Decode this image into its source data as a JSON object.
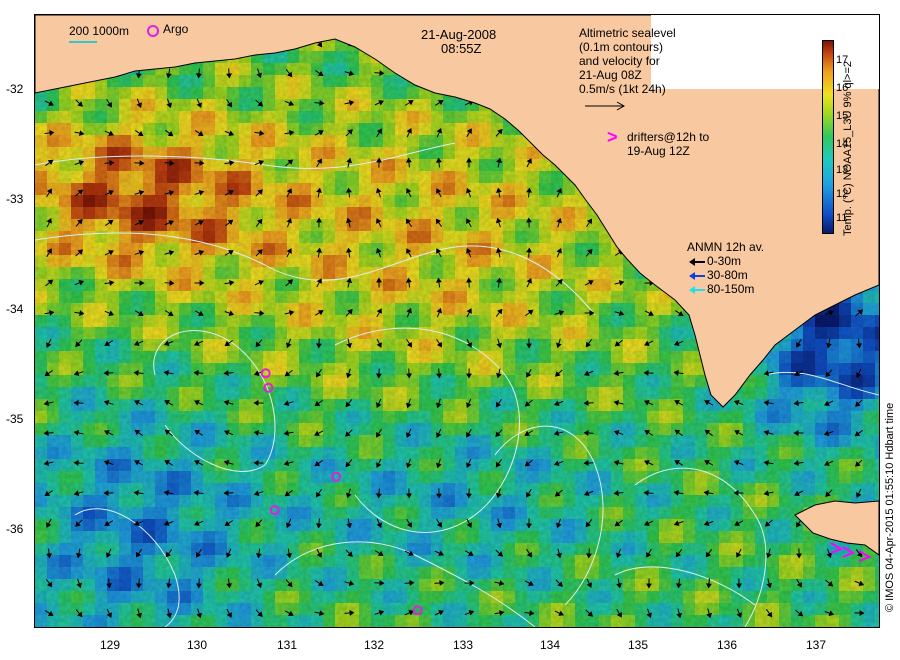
{
  "date": "21-Aug-2008",
  "time": "08:55Z",
  "scale_legend": {
    "label": "200  1000m"
  },
  "argo_legend": {
    "label": "Argo"
  },
  "altimetry_text": [
    "Altimetric sealevel",
    "(0.1m contours)",
    "and velocity for",
    "21-Aug 08Z",
    "0.5m/s (1kt 24h)"
  ],
  "drifters_text": [
    "drifters@12h to",
    "19-Aug 12Z"
  ],
  "drifters_symbol": ">",
  "anmn_legend": {
    "title": "ANMN 12h av.",
    "items": [
      {
        "label": "0-30m",
        "color": "#000000"
      },
      {
        "label": "30-80m",
        "color": "#1040e0"
      },
      {
        "label": "80-150m",
        "color": "#20e0f0"
      }
    ]
  },
  "colorbar": {
    "title": "Temp. (°C) NOAA15_L3U 9% ql>=2",
    "ticks": [
      "17",
      "16",
      "15",
      "14",
      "13",
      "12",
      "11"
    ]
  },
  "credit": "© IMOS 04-Apr-2015 01:55:10 Hdbart time",
  "y_axis_labels": [
    "-32",
    "-33",
    "-34",
    "-35",
    "-36"
  ],
  "x_axis_labels": [
    "129",
    "130",
    "131",
    "132",
    "133",
    "134",
    "135",
    "136",
    "137"
  ],
  "colors": {
    "land": "#f8c8a0",
    "argo": "#e020e0",
    "drifter": "#ff00ff",
    "contour": "#d8f0f0"
  },
  "argo_floats": [
    {
      "lon": 130.77,
      "lat": -34.67
    },
    {
      "lon": 130.8,
      "lat": -34.8
    },
    {
      "lon": 131.55,
      "lat": -35.6
    },
    {
      "lon": 130.87,
      "lat": -35.9
    },
    {
      "lon": 132.45,
      "lat": -36.8
    }
  ]
}
